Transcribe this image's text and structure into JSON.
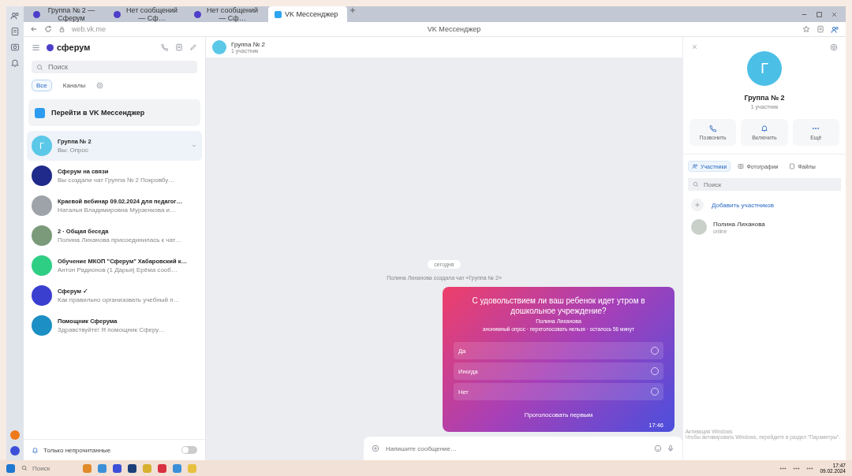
{
  "browser": {
    "tabs": [
      {
        "title": "Группа № 2 — Сферум",
        "selected": false
      },
      {
        "title": "Нет сообщений — Сф…",
        "selected": false
      },
      {
        "title": "Нет сообщений — Сф…",
        "selected": false
      },
      {
        "title": "VK Мессенджер",
        "selected": true
      }
    ],
    "address": "web.vk.me",
    "page_title": "VK Мессенджер"
  },
  "sidebar": {
    "brand": "сферум",
    "search": {
      "placeholder": "Поиск"
    },
    "filters": [
      {
        "label": "Все",
        "selected": true
      },
      {
        "label": "Каналы",
        "selected": false
      }
    ],
    "promo": "Перейти в VK Мессенджер",
    "chats": [
      {
        "name": "Группа № 2",
        "preview": "Вы: Опрос",
        "avatar_letter": "Г",
        "color": "#5bc8e8",
        "selected": true
      },
      {
        "name": "Сферум на связи",
        "preview": "Вы создали чат Группа № 2 Покровбу…",
        "color": "#1f2a8a",
        "selected": false
      },
      {
        "name": "Краевой вебинар 09.02.2024 для педагог…",
        "preview": "Наталья Владимировна Мурзенкова и…",
        "color": "#9ea3aa",
        "selected": false
      },
      {
        "name": "2 · Общая беседа",
        "preview": "Полина Лиханова присоединилась к чат…",
        "color": "#7a9a7a",
        "selected": false
      },
      {
        "name": "Обучение МКОП \"Сферум\" Хабаровский к…",
        "preview": "Антон Радионов (1 Дарья) Ерёма сооб…",
        "color": "#2ecf84",
        "selected": false
      },
      {
        "name": "Сферум ✓",
        "preview": "Как правильно организовать учебный п…",
        "color": "#3b3fd0",
        "selected": false
      },
      {
        "name": "Помощник Сферума",
        "preview": "Здравствуйте! Я помощник Сферу…",
        "color": "#1c8fc4",
        "selected": false
      }
    ],
    "unread_only": {
      "label": "Только непрочитанные",
      "on": false
    }
  },
  "chat": {
    "title": "Группа № 2",
    "subtitle": "1 участник",
    "date": "сегодня",
    "system": "Полина Лиханова создала чат «Группа № 2»",
    "poll": {
      "question": "С удовольствием ли ваш ребенок идет утром в дошкольное учреждение?",
      "author": "Полина Лиханова",
      "meta": "анонимный опрос · переголосовать нельзя · осталось 56 минут",
      "options": [
        "Да",
        "Иногда",
        "Нет"
      ],
      "vote_button": "Проголосовать первым",
      "time": "17:46"
    },
    "composer": {
      "placeholder": "Напишите сообщение…"
    }
  },
  "info": {
    "avatar_letter": "Г",
    "title": "Группа № 2",
    "subtitle": "1 участник",
    "actions": [
      "Позвонить",
      "Включить",
      "Ещё"
    ],
    "tabs": [
      {
        "label": "Участники",
        "selected": true
      },
      {
        "label": "Фотографии",
        "selected": false
      },
      {
        "label": "Файлы",
        "selected": false
      }
    ],
    "search": {
      "placeholder": "Поиск"
    },
    "add": "Добавить участников",
    "members": [
      {
        "name": "Полина Лиханова",
        "status": "online"
      }
    ]
  },
  "activation": {
    "title": "Активация Windows",
    "text": "Чтобы активировать Windows, перейдите в раздел \"Параметры\"."
  },
  "taskbar": {
    "search": {
      "placeholder": "Поиск"
    },
    "time": "17:47",
    "date": "09.02.2024"
  }
}
